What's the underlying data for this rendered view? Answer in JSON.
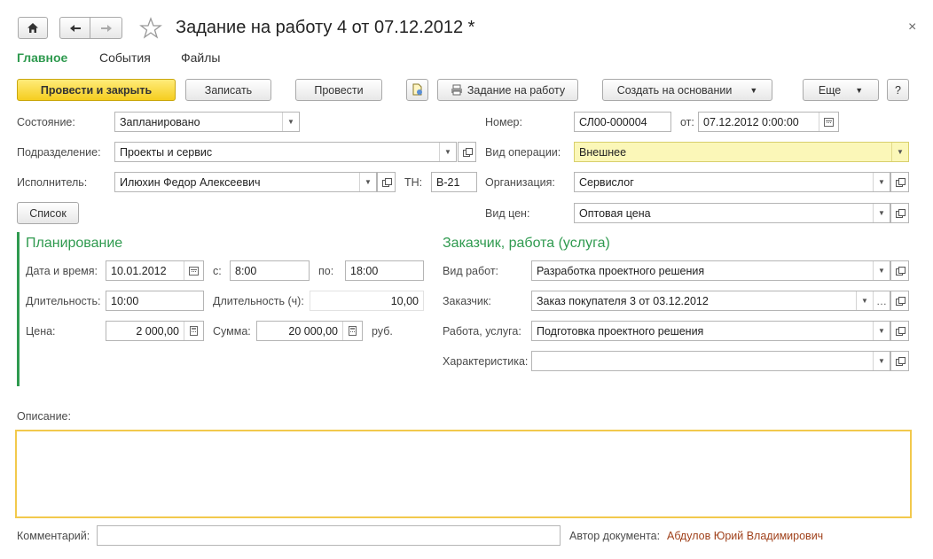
{
  "window": {
    "title": "Задание на работу 4 от 07.12.2012 *",
    "close_glyph": "×"
  },
  "tabs": [
    {
      "label": "Главное",
      "active": true
    },
    {
      "label": "События",
      "active": false
    },
    {
      "label": "Файлы",
      "active": false
    }
  ],
  "toolbar": {
    "post_and_close": "Провести и закрыть",
    "save": "Записать",
    "post": "Провести",
    "print_task": "Задание на работу",
    "create_based_on": "Создать на основании",
    "more": "Еще",
    "help": "?"
  },
  "left": {
    "state_label": "Состояние:",
    "state_value": "Запланировано",
    "department_label": "Подразделение:",
    "department_value": "Проекты и сервис",
    "executor_label": "Исполнитель:",
    "executor_value": "Илюхин Федор Алексеевич",
    "tn_label": "ТН:",
    "tn_value": "В-21",
    "list_button": "Список"
  },
  "right": {
    "number_label": "Номер:",
    "number_value": "СЛ00-000004",
    "from_label": "от:",
    "date_value": "07.12.2012  0:00:00",
    "operation_label": "Вид операции:",
    "operation_value": "Внешнее",
    "organization_label": "Организация:",
    "organization_value": "Сервислог",
    "price_type_label": "Вид цен:",
    "price_type_value": "Оптовая цена"
  },
  "planning": {
    "title": "Планирование",
    "datetime_label": "Дата и время:",
    "date_value": "10.01.2012",
    "from_label": "с:",
    "from_value": "8:00",
    "to_label": "по:",
    "to_value": "18:00",
    "duration_label": "Длительность:",
    "duration_value": "10:00",
    "duration_h_label": "Длительность (ч):",
    "duration_h_value": "10,00",
    "price_label": "Цена:",
    "price_value": "2 000,00",
    "sum_label": "Сумма:",
    "sum_value": "20 000,00",
    "currency": "руб."
  },
  "customer": {
    "title": "Заказчик, работа (услуга)",
    "work_type_label": "Вид работ:",
    "work_type_value": "Разработка проектного решения",
    "customer_label": "Заказчик:",
    "customer_value": "Заказ покупателя 3 от 03.12.2012",
    "work_label": "Работа, услуга:",
    "work_value": "Подготовка проектного решения",
    "characteristic_label": "Характеристика:",
    "characteristic_value": ""
  },
  "description": {
    "label": "Описание:",
    "value": ""
  },
  "footer": {
    "comment_label": "Комментарий:",
    "comment_value": "",
    "author_label": "Автор документа:",
    "author_value": "Абдулов Юрий Владимирович"
  },
  "colors": {
    "accent_green": "#2f9a4f",
    "primary_button": "#f5cd1f",
    "highlight_field": "#fbf7b8",
    "description_border": "#f2c94c",
    "author_link": "#a0411b"
  }
}
